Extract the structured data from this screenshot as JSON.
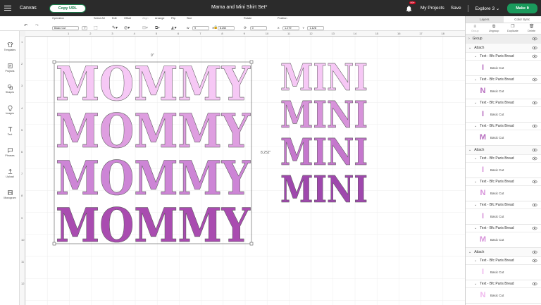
{
  "topbar": {
    "canvas_label": "Canvas",
    "copy_url_label": "Copy URL",
    "project_title": "Mama and Mini Shirt Set*",
    "notification_badge": "99+",
    "my_projects": "My Projects",
    "save": "Save",
    "explore": "Explore 3",
    "make_it": "Make It"
  },
  "toolbar": {
    "operation_label": "Operation",
    "operation_value": "Basic Cut",
    "select_all_label": "Select All",
    "edit_label": "Edit",
    "offset_label": "Offset",
    "align_label": "Align",
    "arrange_label": "Arrange",
    "flip_label": "Flip",
    "size_label": "Size",
    "width_letter": "W",
    "width_value": "9",
    "height_letter": "H",
    "height_value": "8.252",
    "rotate_label": "Rotate",
    "rotate_value": "0",
    "position_label": "Position",
    "x_letter": "X",
    "x_value": "1.279",
    "y_letter": "Y",
    "y_value": "1.128"
  },
  "ruler": {
    "h_ticks": [
      "1",
      "2",
      "3",
      "4",
      "5",
      "6",
      "7",
      "8",
      "9",
      "10",
      "11",
      "12",
      "13",
      "14",
      "15",
      "16",
      "17",
      "18"
    ],
    "v_ticks": [
      "1",
      "2",
      "3",
      "4",
      "5",
      "6",
      "7",
      "8",
      "9",
      "10",
      "11",
      "12"
    ]
  },
  "sidebar": {
    "items": [
      "New",
      "Templates",
      "Projects",
      "Shapes",
      "Images",
      "Text",
      "Phrases",
      "Upload",
      "Monogram"
    ]
  },
  "canvas": {
    "mommy_word": "MOMMY",
    "mini_word": "MINI",
    "width_dim": "9\"",
    "height_dim": "8.252\"",
    "colors": {
      "mommy": [
        "#f6c8f5",
        "#de9ee0",
        "#cd85d6",
        "#a94cb0"
      ],
      "mini": [
        "#f6c8f5",
        "#d793da",
        "#c577cd",
        "#9f48ad"
      ],
      "outline": "#555555"
    }
  },
  "panel": {
    "tabs": [
      "Layers",
      "Color Sync"
    ],
    "actions": [
      "Group",
      "Ungroup",
      "Duplicate",
      "Delete"
    ],
    "layers": [
      {
        "type": "group",
        "label": "Group"
      },
      {
        "type": "attach",
        "label": "Attach"
      },
      {
        "type": "text",
        "label": "Text - Bfc Paris Bread"
      },
      {
        "type": "sub",
        "label": "Basic Cut",
        "glyph": "I",
        "color": "#b86fc0"
      },
      {
        "type": "text",
        "label": "Text - Bfc Paris Bread"
      },
      {
        "type": "sub",
        "label": "Basic Cut",
        "glyph": "N",
        "color": "#b86fc0"
      },
      {
        "type": "text",
        "label": "Text - Bfc Paris Bread"
      },
      {
        "type": "sub",
        "label": "Basic Cut",
        "glyph": "I",
        "color": "#b86fc0"
      },
      {
        "type": "text",
        "label": "Text - Bfc Paris Bread"
      },
      {
        "type": "sub",
        "label": "Basic Cut",
        "glyph": "M",
        "color": "#b86fc0"
      },
      {
        "type": "attach",
        "label": "Attach"
      },
      {
        "type": "text",
        "label": "Text - Bfc Paris Bread"
      },
      {
        "type": "sub",
        "label": "Basic Cut",
        "glyph": "I",
        "color": "#d793da"
      },
      {
        "type": "text",
        "label": "Text - Bfc Paris Bread"
      },
      {
        "type": "sub",
        "label": "Basic Cut",
        "glyph": "N",
        "color": "#d793da"
      },
      {
        "type": "text",
        "label": "Text - Bfc Paris Bread"
      },
      {
        "type": "sub",
        "label": "Basic Cut",
        "glyph": "I",
        "color": "#d793da"
      },
      {
        "type": "text",
        "label": "Text - Bfc Paris Bread"
      },
      {
        "type": "sub",
        "label": "Basic Cut",
        "glyph": "M",
        "color": "#d793da"
      },
      {
        "type": "attach",
        "label": "Attach"
      },
      {
        "type": "text",
        "label": "Text - Bfc Paris Bread"
      },
      {
        "type": "sub",
        "label": "Basic Cut",
        "glyph": "I",
        "color": "#f0b8ee"
      },
      {
        "type": "text",
        "label": "Text - Bfc Paris Bread"
      },
      {
        "type": "sub",
        "label": "Basic Cut",
        "glyph": "N",
        "color": "#f0b8ee"
      }
    ]
  }
}
